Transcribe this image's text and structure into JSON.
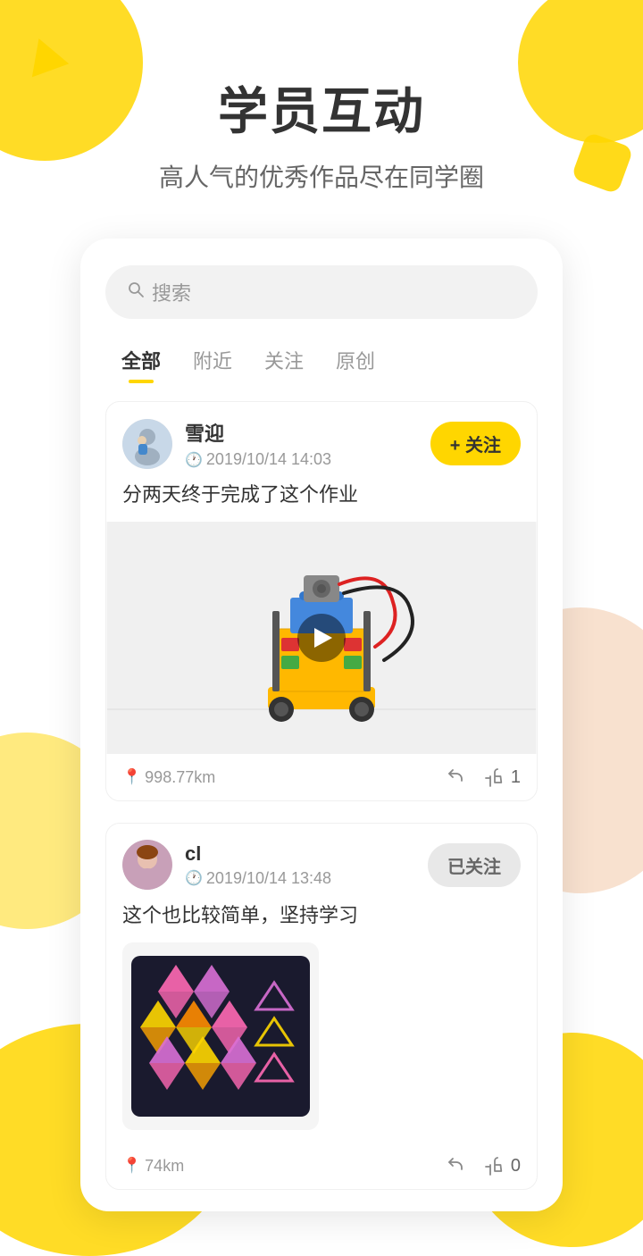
{
  "page": {
    "title": "学员互动",
    "subtitle": "高人气的优秀作品尽在同学圈"
  },
  "search": {
    "placeholder": "搜索",
    "icon": "🔍"
  },
  "tabs": [
    {
      "label": "全部",
      "active": true
    },
    {
      "label": "附近",
      "active": false
    },
    {
      "label": "关注",
      "active": false
    },
    {
      "label": "原创",
      "active": false
    }
  ],
  "posts": [
    {
      "username": "雪迎",
      "time": "2019/10/14 14:03",
      "follow_label": "+ 关注",
      "followed": false,
      "text": "分两天终于完成了这个作业",
      "location": "998.77km",
      "share_icon": "share",
      "like_icon": "like",
      "like_count": "1"
    },
    {
      "username": "cl",
      "time": "2019/10/14 13:48",
      "follow_label": "已关注",
      "followed": true,
      "text": "这个也比较简单，坚持学习",
      "location": "74km",
      "share_icon": "share",
      "like_icon": "like",
      "like_count": "0"
    }
  ]
}
